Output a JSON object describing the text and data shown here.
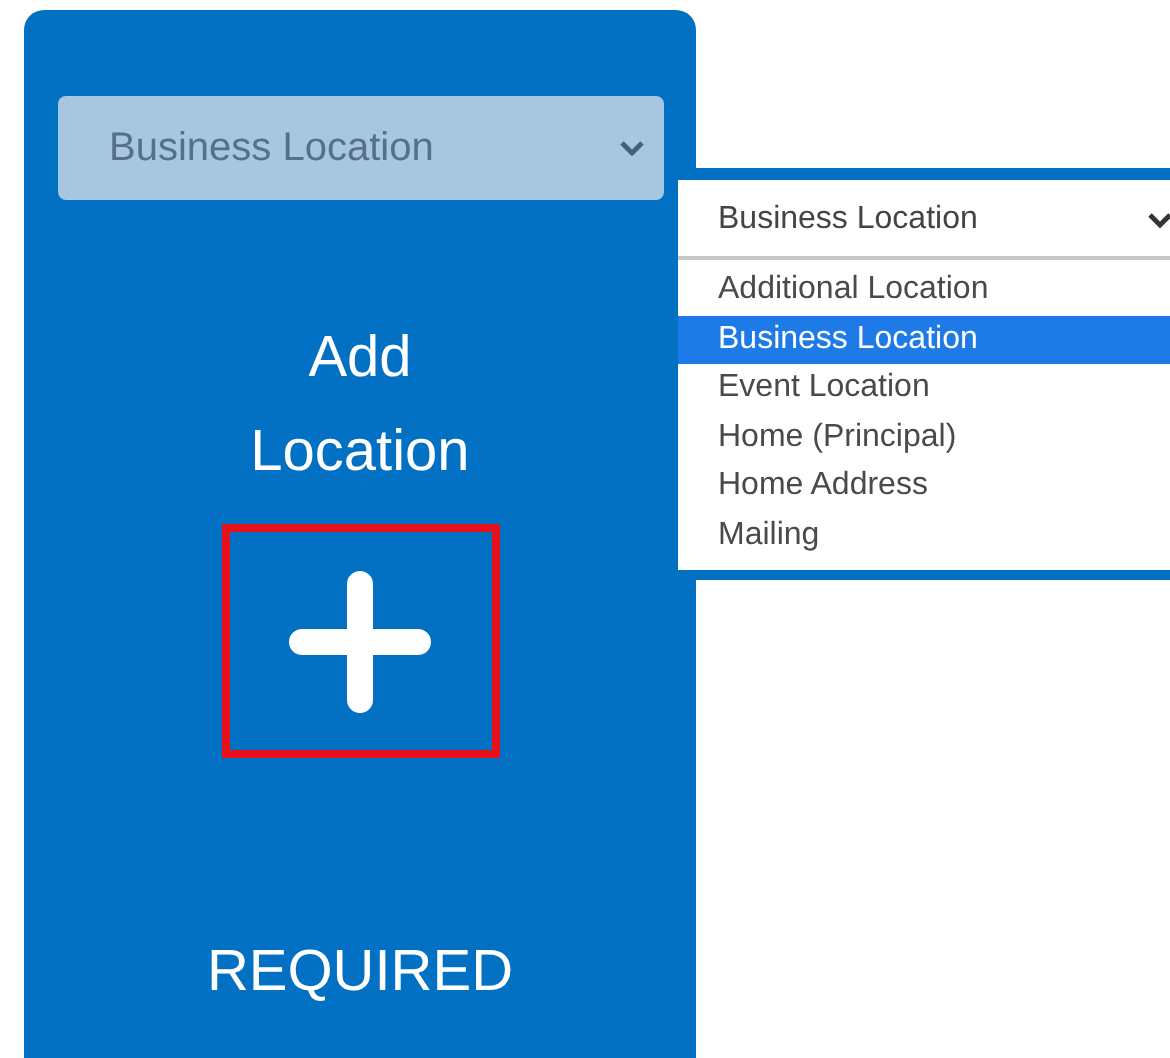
{
  "card": {
    "select": {
      "value": "Business Location"
    },
    "title": "Add Location",
    "add_button": {
      "highlighted": true
    },
    "status": "REQUIRED"
  },
  "dropdown": {
    "select": {
      "value": "Business Location"
    },
    "options": [
      {
        "label": "Additional Location",
        "selected": false
      },
      {
        "label": "Business Location",
        "selected": true
      },
      {
        "label": "Event Location",
        "selected": false
      },
      {
        "label": "Home (Principal)",
        "selected": false
      },
      {
        "label": "Home Address",
        "selected": false
      },
      {
        "label": "Mailing",
        "selected": false
      }
    ]
  }
}
